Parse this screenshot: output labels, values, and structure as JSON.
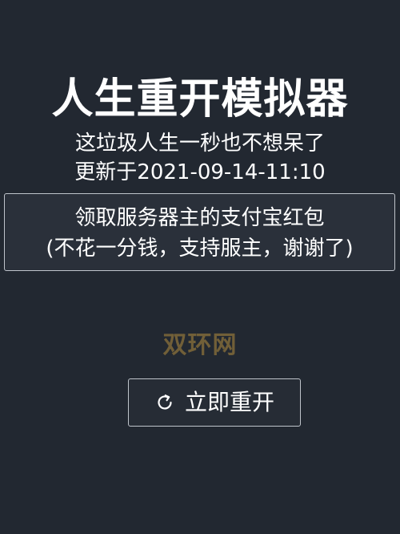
{
  "header": {
    "title": "人生重开模拟器",
    "subtitle": "这垃圾人生一秒也不想呆了",
    "updated": "更新于2021-09-14-11:10"
  },
  "redpacket": {
    "line1": "领取服务器主的支付宝红包",
    "line2": "(不花一分钱，支持服主，谢谢了)"
  },
  "watermark": {
    "text": "双环网"
  },
  "restart_button": {
    "icon": "refresh-icon",
    "label": "立即重开"
  },
  "colors": {
    "background": "#222831",
    "text": "#ffffff",
    "border": "#bfc4cb",
    "watermark": "#7a6539"
  }
}
